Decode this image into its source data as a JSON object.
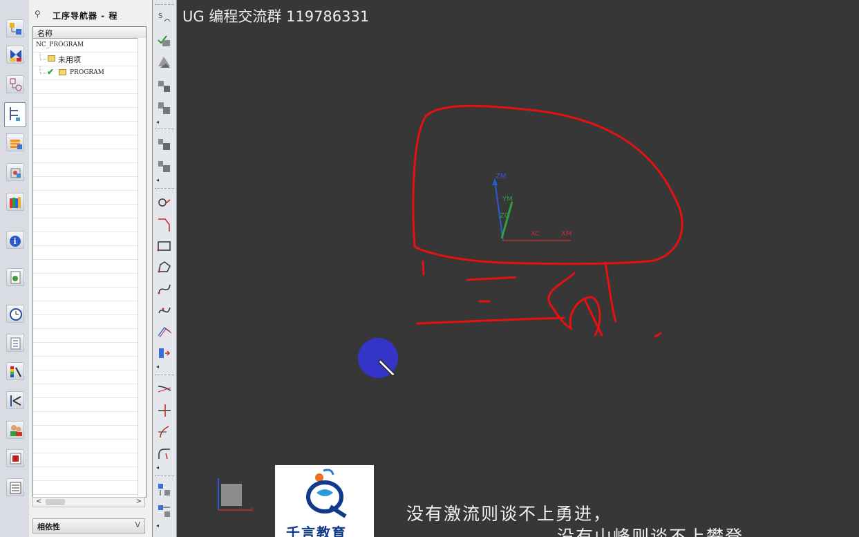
{
  "navigator": {
    "title": "工序导航器 - 程",
    "pin_glyph": "⚲",
    "column_header": "名称",
    "tree": [
      {
        "label": "NC_PROGRAM"
      },
      {
        "label": "未用项"
      },
      {
        "label": "PROGRAM",
        "status": "complete"
      }
    ],
    "scroll_left": "<",
    "scroll_right": ">",
    "dependency_title": "相依性",
    "dependency_toggle": "V"
  },
  "graphics": {
    "title": "UG 编程交流群 119786331",
    "wcs_labels": {
      "zm": "ZM",
      "ym": "YM",
      "zc": "ZC",
      "xc": "XC",
      "xm": "XM"
    },
    "triad_label": "X"
  },
  "logo": {
    "text": "千言教育"
  },
  "captions": {
    "line1": "没有激流则谈不上勇进，",
    "line2": "没有山峰则谈不上攀登"
  },
  "colors": {
    "background": "#373737",
    "annotation": "#e81010",
    "highlight": "#3434c8"
  }
}
